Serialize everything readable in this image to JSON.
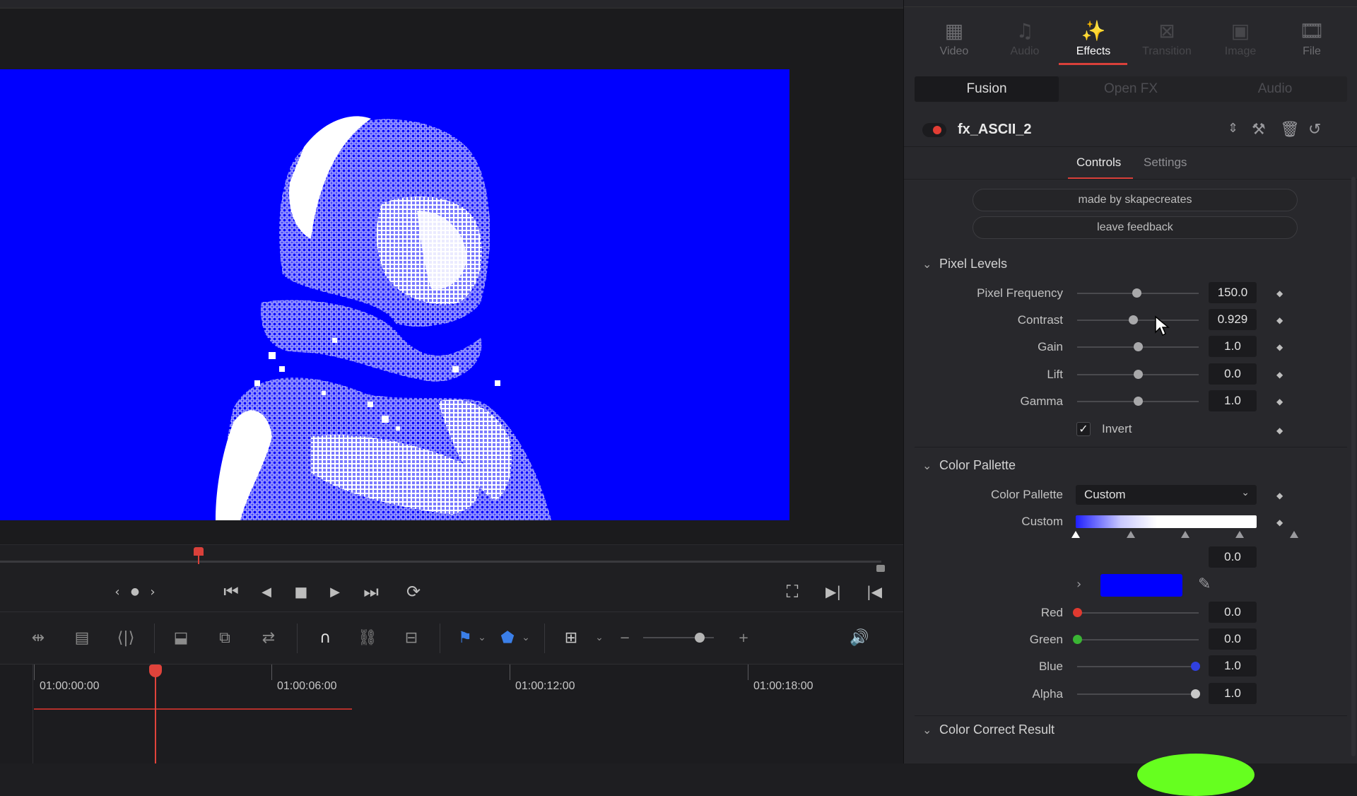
{
  "viewer": {
    "background_color": "#0000ff",
    "image_description_icon": "astronaut-ascii-art"
  },
  "transport": {
    "icons": [
      "nav-prev-icon",
      "nav-dot-icon",
      "nav-next-icon",
      "skip-to-start-icon",
      "step-back-icon",
      "stop-icon",
      "play-icon",
      "skip-to-end-icon",
      "loop-icon",
      "fullscreen-icon",
      "next-clip-icon",
      "prev-clip-icon"
    ]
  },
  "timeline": {
    "timecodes": [
      "01:00:00:00",
      "01:00:06:00",
      "01:00:12:00",
      "01:00:18:00"
    ]
  },
  "inspector": {
    "tabs": [
      {
        "label": "Video",
        "icon": "video-icon",
        "state": "normal"
      },
      {
        "label": "Audio",
        "icon": "audio-icon",
        "state": "dim"
      },
      {
        "label": "Effects",
        "icon": "effects-wand-icon",
        "state": "active"
      },
      {
        "label": "Transition",
        "icon": "transition-icon",
        "state": "dim"
      },
      {
        "label": "Image",
        "icon": "image-icon",
        "state": "dim"
      },
      {
        "label": "File",
        "icon": "file-icon",
        "state": "normal"
      }
    ],
    "subtabs": [
      {
        "label": "Fusion",
        "active": true
      },
      {
        "label": "Open FX",
        "active": false
      },
      {
        "label": "Audio",
        "active": false
      }
    ],
    "effect_name": "fx_ASCII_2",
    "control_tabs": {
      "controls": "Controls",
      "settings": "Settings"
    },
    "buttons": {
      "made_by": "made by skapecreates",
      "feedback": "leave feedback"
    },
    "pixel_levels": {
      "title": "Pixel Levels",
      "params": [
        {
          "label": "Pixel Frequency",
          "value": "150.0",
          "level": 0.49
        },
        {
          "label": "Contrast",
          "value": "0.929",
          "level": 0.46
        },
        {
          "label": "Gain",
          "value": "1.0",
          "level": 0.5
        },
        {
          "label": "Lift",
          "value": "0.0",
          "level": 0.5
        },
        {
          "label": "Gamma",
          "value": "1.0",
          "level": 0.5
        }
      ],
      "invert": {
        "label": "Invert",
        "checked": true
      }
    },
    "color_pallette": {
      "title": "Color Pallette",
      "dropdown_label": "Color Pallette",
      "dropdown_value": "Custom",
      "gradient_label": "Custom",
      "position_value": "0.0",
      "swatch_color": "#0000ff",
      "channels": [
        {
          "label": "Red",
          "value": "0.0",
          "level": 0.0,
          "color": "#e03a30"
        },
        {
          "label": "Green",
          "value": "0.0",
          "level": 0.0,
          "color": "#3ab534"
        },
        {
          "label": "Blue",
          "value": "1.0",
          "level": 0.97,
          "color": "#3040e0"
        },
        {
          "label": "Alpha",
          "value": "1.0",
          "level": 0.97,
          "color": "#c8c8c8"
        }
      ]
    },
    "color_correct": {
      "title": "Color Correct Result"
    }
  }
}
